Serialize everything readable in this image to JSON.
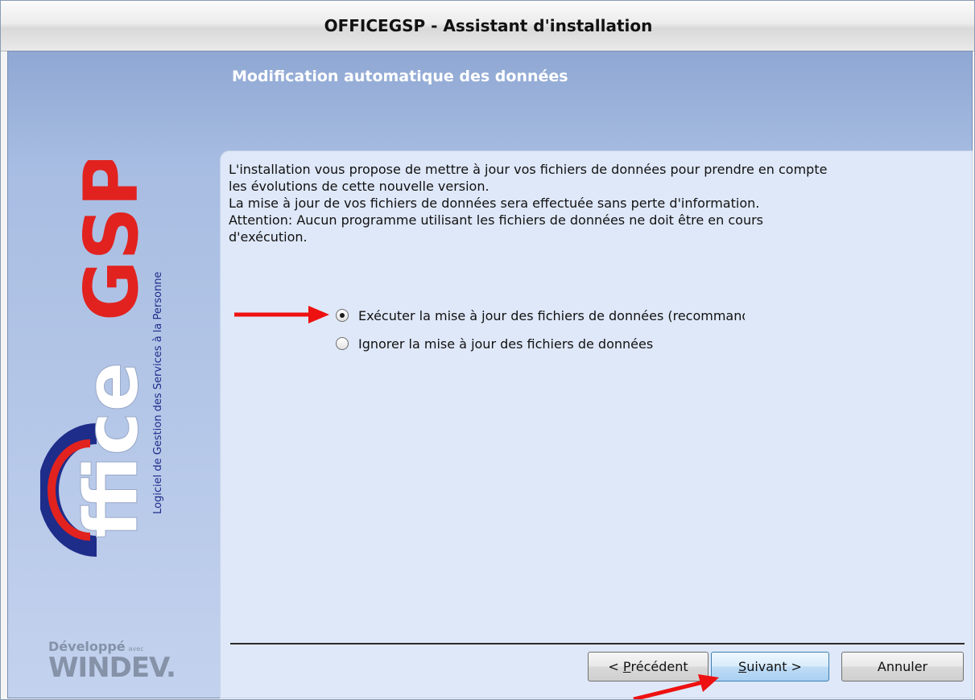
{
  "window": {
    "title": "OFFICEGSP - Assistant d'installation"
  },
  "header": {
    "heading": "Modification automatique des données"
  },
  "description": [
    "L'installation vous propose de mettre à jour vos fichiers de données pour prendre en compte",
    "les évolutions de cette nouvelle version.",
    "La mise à jour de vos fichiers de données sera effectuée sans perte d'information.",
    "Attention: Aucun programme utilisant les fichiers de données ne doit être en cours",
    "d'exécution."
  ],
  "options": [
    {
      "label": "Exécuter la mise à jour des fichiers de données (recommandé)",
      "selected": true
    },
    {
      "label": "Ignorer la mise à jour des fichiers de données",
      "selected": false
    }
  ],
  "buttons": {
    "previous": {
      "prefix": "< ",
      "mnemonic": "P",
      "rest": "récédent"
    },
    "next": {
      "mnemonic": "S",
      "rest": "uivant >"
    },
    "cancel": "Annuler"
  },
  "logo": {
    "letters": "ffice",
    "brand": "GSP",
    "tagline": "Logiciel de Gestion des Services à la Personne",
    "colors": {
      "brand_red": "#e1221f",
      "blue": "#1e2c8a"
    }
  },
  "footer_logo": {
    "developed": "Développé",
    "avec": "avec",
    "product": "WINDEV."
  },
  "annotation_arrow_color": "#ee1111"
}
